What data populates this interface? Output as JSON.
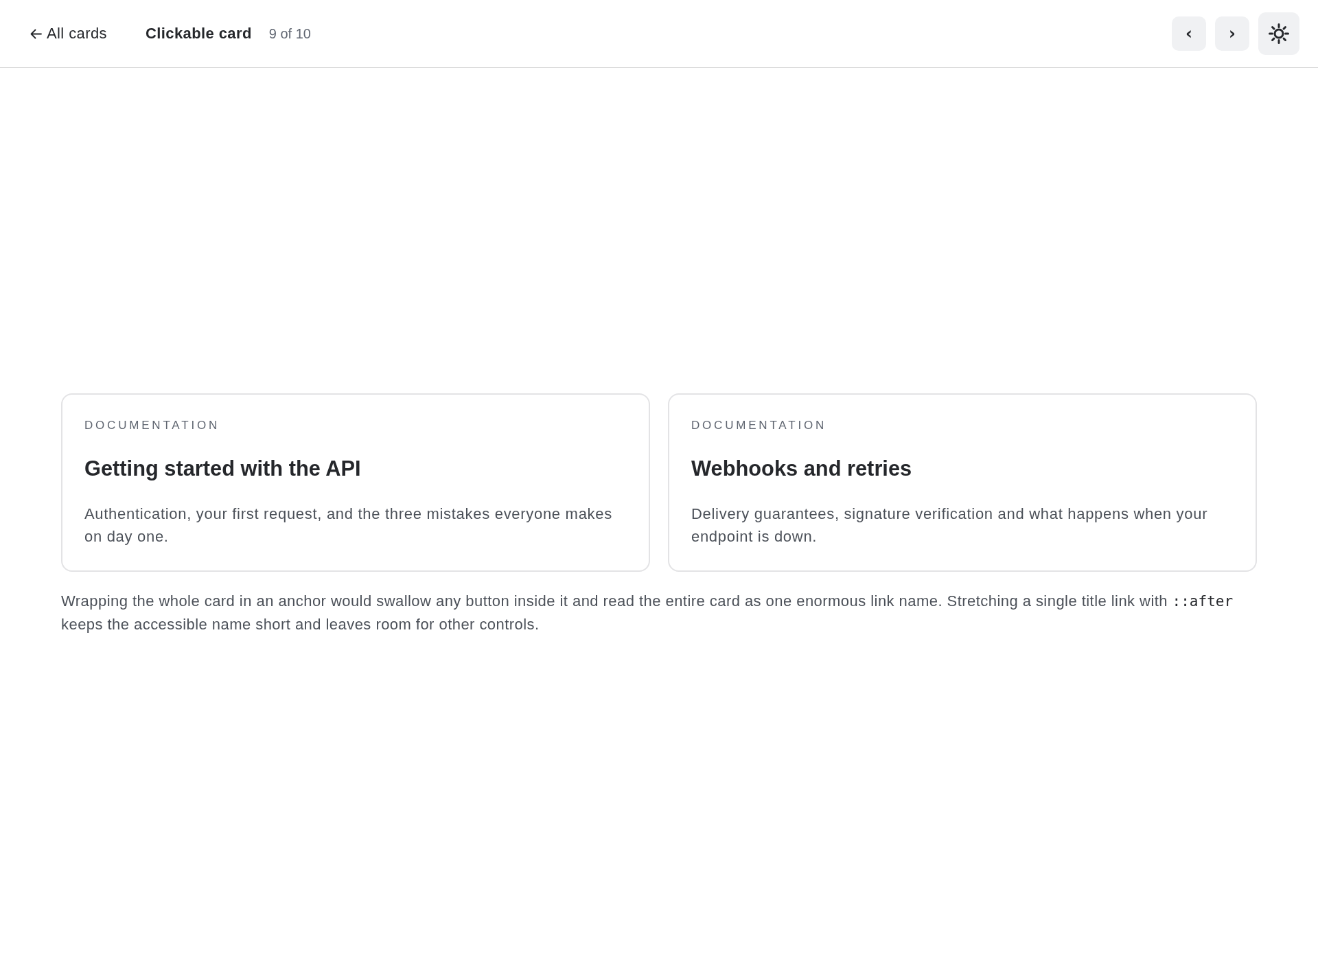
{
  "header": {
    "back_link": {
      "label": "All cards"
    },
    "title": "Clickable card",
    "position": "9 of 10",
    "nav_buttons": [
      "‹",
      "›"
    ]
  },
  "cards": [
    {
      "eyebrow": "DOCUMENTATION",
      "title": "Getting started with the API",
      "description": "Authentication, your first request, and the three mistakes everyone makes on day one."
    },
    {
      "eyebrow": "DOCUMENTATION",
      "title": "Webhooks and retries",
      "description": "Delivery guarantees, signature verification and what happens when your endpoint is down."
    }
  ],
  "note": {
    "parts": [
      {
        "kind": "text",
        "text": "Wrapping the whole card in an anchor would swallow any button inside it and read the entire card as one enormous link name. Stretching a single title link with "
      },
      {
        "kind": "code",
        "text": "::after"
      },
      {
        "kind": "text",
        "text": " keeps the accessible name short and leaves room for other controls."
      }
    ]
  }
}
